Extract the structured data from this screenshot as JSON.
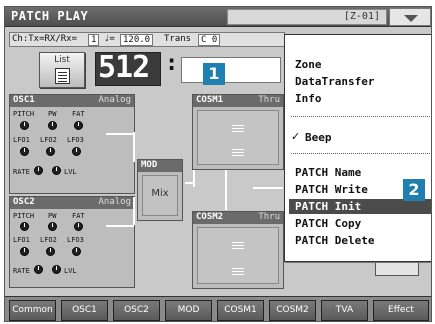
{
  "titlebar": {
    "title": "PATCH PLAY",
    "zone_indicator": "[Z-01]"
  },
  "info": {
    "ch_label": "Ch:Tx=RX/Rx=",
    "ch_value": "1",
    "tempo_symbol": "♩=",
    "tempo_value": "120.0",
    "trans_label": "Trans",
    "trans_value": "C 0"
  },
  "patch": {
    "list_label": "List",
    "number": "512",
    "colon": ":"
  },
  "callouts": {
    "one": "1",
    "two": "2"
  },
  "osc1": {
    "name": "OSC1",
    "type": "Analog",
    "params_row1": [
      "PITCH",
      "PW",
      "FAT"
    ],
    "params_row2": [
      "LFO1",
      "LFO2",
      "LFO3"
    ],
    "rate": "RATE",
    "lvl": "LVL"
  },
  "osc2": {
    "name": "OSC2",
    "type": "Analog",
    "params_row1": [
      "PITCH",
      "PW",
      "FAT"
    ],
    "params_row2": [
      "LFO1",
      "LFO2",
      "LFO3"
    ],
    "rate": "RATE",
    "lvl": "LVL"
  },
  "mod": {
    "name": "MOD",
    "value": "Mix"
  },
  "cosm1": {
    "name": "COSM1",
    "type": "Thru"
  },
  "cosm2": {
    "name": "COSM2",
    "type": "Thru"
  },
  "menu": {
    "items_top": [
      "Zone",
      "DataTransfer",
      "Info"
    ],
    "beep_check": "✓",
    "beep": "Beep",
    "items_bottom": [
      "PATCH Name",
      "PATCH Write",
      "PATCH Init",
      "PATCH Copy",
      "PATCH Delete"
    ],
    "selected": "PATCH Init"
  },
  "tabs": [
    "Common",
    "OSC1",
    "OSC2",
    "MOD",
    "COSM1",
    "COSM2",
    "TVA",
    "Effect"
  ],
  "colors": {
    "callout": "#1f7fb0",
    "titlebar": "#5a5a5a",
    "panel": "#c9c9c9",
    "menu_selected": "#4b4b4b"
  }
}
